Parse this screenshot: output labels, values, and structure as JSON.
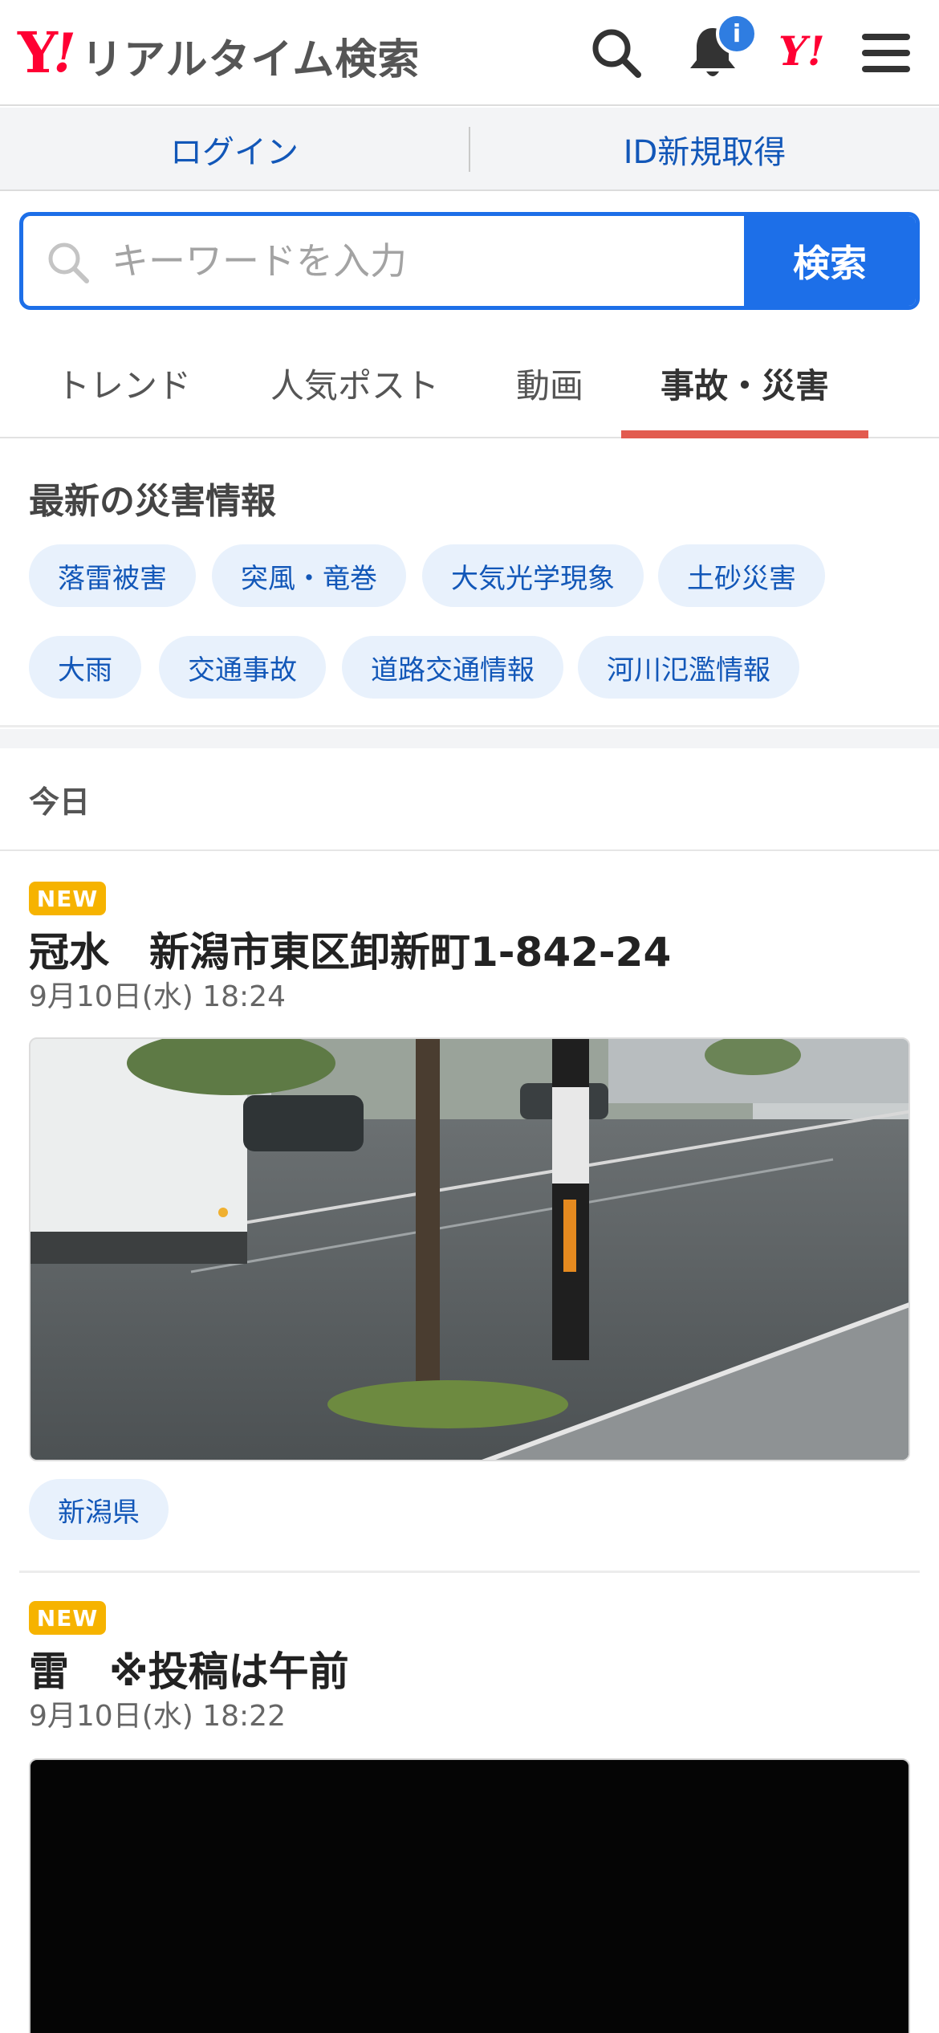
{
  "header": {
    "logo_y": "Y",
    "logo_ex": "!",
    "logo_text": "リアルタイム検索",
    "notification_count": "i",
    "mini_logo": "Y!"
  },
  "auth": {
    "login": "ログイン",
    "register": "ID新規取得"
  },
  "search": {
    "placeholder": "キーワードを入力",
    "button": "検索"
  },
  "tabs": [
    {
      "label": "トレンド"
    },
    {
      "label": "人気ポスト"
    },
    {
      "label": "動画"
    },
    {
      "label": "事故・災害",
      "active": true
    }
  ],
  "disaster": {
    "heading": "最新の災害情報",
    "tags": [
      "落雷被害",
      "突風・竜巻",
      "大気光学現象",
      "土砂災害",
      "大雨",
      "交通事故",
      "道路交通情報",
      "河川氾濫情報"
    ]
  },
  "section_label": "今日",
  "posts": [
    {
      "badge": "NEW",
      "title": "冠水　新潟市東区卸新町1-842-24",
      "date": "9月10日(水) 18:24",
      "location": "新潟県"
    },
    {
      "badge": "NEW",
      "title": "雷　※投稿は午前",
      "date": "9月10日(水) 18:22"
    }
  ],
  "colors": {
    "brand_red": "#ff0033",
    "accent_blue": "#1d6fe8",
    "tab_underline": "#e25b4f",
    "new_badge": "#f6b300"
  }
}
